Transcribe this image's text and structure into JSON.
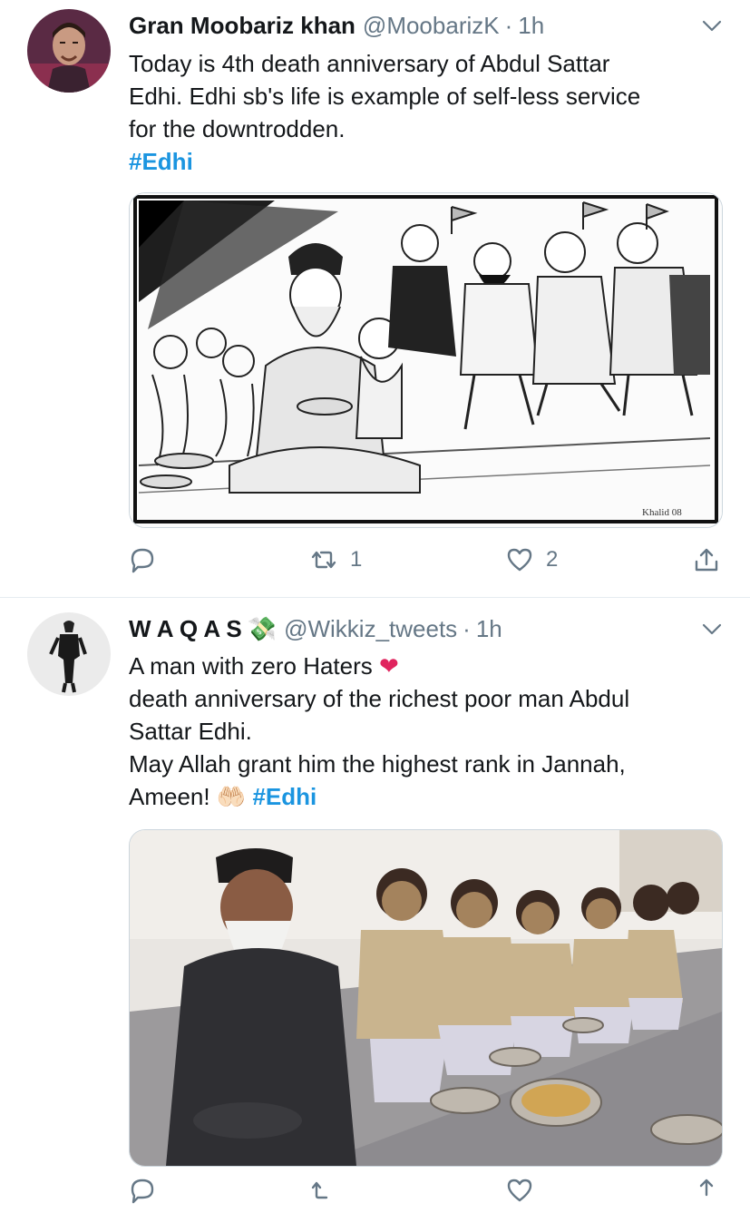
{
  "tweets": [
    {
      "name": "Gran Moobariz khan",
      "handle": "@MoobarizK",
      "separator": "·",
      "time": "1h",
      "lines": [
        "Today is 4th death anniversary of Abdul Sattar",
        "Edhi. Edhi sb's life is example of self-less service",
        "for the downtrodden."
      ],
      "hashtag": "#Edhi",
      "media_signature": "Khalid 08",
      "retweets": "1",
      "likes": "2"
    },
    {
      "name": "W A Q A S",
      "name_emoji": "💸",
      "handle": "@Wikkiz_tweets",
      "separator": "·",
      "time": "1h",
      "line1": "A man with zero Haters",
      "line1_emoji": "❤",
      "line2": "death anniversary of the richest poor man Abdul",
      "line3": "Sattar Edhi.",
      "line4": "May Allah grant him the highest rank in Jannah,",
      "line5": "Ameen!",
      "line5_emoji": "🤲🏻",
      "hashtag": "#Edhi"
    }
  ],
  "icons": [
    "reply-icon",
    "retweet-icon",
    "like-icon",
    "share-icon",
    "chevron-down-icon"
  ],
  "colors": {
    "link": "#1b95e0",
    "muted": "#657786",
    "heart": "#e0245e",
    "divider": "#e6ecf0"
  }
}
